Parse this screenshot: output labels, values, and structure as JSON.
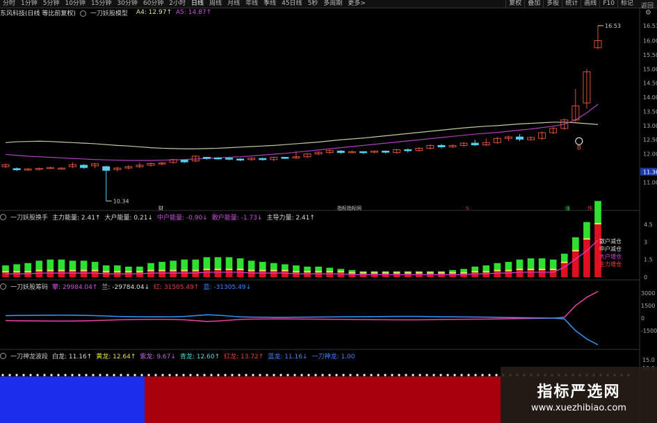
{
  "toolbar": {
    "periods": [
      "分时",
      "1分钟",
      "5分钟",
      "10分钟",
      "15分钟",
      "30分钟",
      "60分钟",
      "2小时",
      "日线",
      "周线",
      "月线",
      "年线",
      "季线",
      "45日线",
      "5秒",
      "多周期",
      "更多>"
    ],
    "active_index": 8,
    "right": [
      "复权",
      "叠加",
      "多股",
      "统计",
      "画线",
      "F10",
      "标记"
    ],
    "corner": "返回"
  },
  "main": {
    "stock": "东风科技(日线 等比前复权)",
    "indicator": "一刀妖股模型",
    "a4": "A4: 12.97↑",
    "a5": "A5: 14.87↑",
    "high_label": "16.53",
    "low_label": "10.34",
    "marker_b": "B",
    "bottom_labels": [
      "财",
      "指标指标网",
      "S",
      "涨",
      "炸"
    ],
    "axis": [
      "16.53",
      "16.00",
      "15.50",
      "15.00",
      "14.50",
      "14.00",
      "13.50",
      "13.00",
      "12.50",
      "12.00",
      "11.36",
      "11.00"
    ],
    "price_tag": "11.36"
  },
  "pane2": {
    "title": "一刀妖股换手",
    "items": [
      "主力能量: 2.41↑",
      "大户能量: 0.21↓",
      "中户能量: -0.90↓",
      "散户能量: -1.73↓",
      "主导力量: 2.41↑"
    ],
    "legend": [
      "散户减仓",
      "中户减仓",
      "大户增仓",
      "主力增仓"
    ],
    "axis": [
      "4.5",
      "3",
      "1.5",
      "0"
    ]
  },
  "pane3": {
    "title": "一刀妖股筹码",
    "items": [
      "攀: 29984.04↑",
      "兰: -29784.04↓",
      "红: 31505.49↑",
      "蓝: -31305.49↓"
    ],
    "axis": [
      "3000",
      "1500",
      "0",
      "-1500"
    ]
  },
  "pane4": {
    "title": "一刀神龙波段",
    "items": [
      "白龙: 11.16↑",
      "黄龙: 12.64↑",
      "紫龙: 9.67↓",
      "青龙: 12.60↑",
      "红龙: 13.72↑",
      "蓝龙: 11.16↓",
      "一刀神龙: 1.00"
    ],
    "axis": [
      "15.0",
      "10.0"
    ]
  },
  "watermark": {
    "title": "指标严选网",
    "url": "www.xuezhibiao.com"
  },
  "colors": {
    "up": "#e0503a",
    "down": "#5ad0f0",
    "ma1": "#c8c8a0",
    "ma2": "#b040c0"
  },
  "chart_data": {
    "type": "candlestick",
    "candles": [
      [
        11.55,
        11.62,
        11.5,
        11.66
      ],
      [
        11.48,
        11.44,
        11.4,
        11.52
      ],
      [
        11.43,
        11.47,
        11.4,
        11.5
      ],
      [
        11.45,
        11.49,
        11.42,
        11.52
      ],
      [
        11.5,
        11.52,
        11.48,
        11.55
      ],
      [
        11.5,
        11.5,
        11.47,
        11.53
      ],
      [
        11.55,
        11.62,
        11.5,
        11.7
      ],
      [
        11.6,
        11.52,
        11.48,
        11.64
      ],
      [
        11.58,
        11.65,
        11.5,
        11.68
      ],
      [
        11.55,
        11.42,
        10.34,
        11.58
      ],
      [
        11.45,
        11.5,
        11.38,
        11.55
      ],
      [
        11.5,
        11.55,
        11.45,
        11.6
      ],
      [
        11.55,
        11.6,
        11.5,
        11.7
      ],
      [
        11.6,
        11.66,
        11.55,
        11.7
      ],
      [
        11.65,
        11.68,
        11.6,
        11.72
      ],
      [
        11.7,
        11.8,
        11.65,
        11.83
      ],
      [
        11.78,
        11.72,
        11.68,
        11.8
      ],
      [
        11.75,
        11.92,
        11.72,
        11.95
      ],
      [
        11.88,
        11.84,
        11.8,
        11.9
      ],
      [
        11.86,
        11.84,
        11.8,
        11.88
      ],
      [
        11.85,
        11.82,
        11.78,
        11.88
      ],
      [
        11.82,
        11.8,
        11.75,
        11.85
      ],
      [
        11.8,
        11.85,
        11.76,
        11.88
      ],
      [
        11.84,
        11.8,
        11.76,
        11.86
      ],
      [
        11.8,
        11.88,
        11.75,
        11.9
      ],
      [
        11.88,
        11.86,
        11.82,
        11.9
      ],
      [
        11.86,
        11.9,
        11.82,
        12.1
      ],
      [
        11.9,
        12.0,
        11.85,
        12.03
      ],
      [
        12.0,
        12.06,
        11.95,
        12.1
      ],
      [
        12.05,
        12.12,
        12.0,
        12.15
      ],
      [
        12.1,
        12.05,
        12.0,
        12.14
      ],
      [
        12.05,
        12.08,
        12.02,
        12.12
      ],
      [
        12.08,
        12.05,
        12.0,
        12.1
      ],
      [
        12.06,
        12.1,
        12.02,
        12.12
      ],
      [
        12.1,
        12.06,
        12.02,
        12.12
      ],
      [
        12.05,
        12.15,
        12.0,
        12.18
      ],
      [
        12.15,
        12.12,
        12.05,
        12.2
      ],
      [
        12.12,
        12.2,
        12.08,
        12.24
      ],
      [
        12.2,
        12.3,
        12.15,
        12.34
      ],
      [
        12.3,
        12.25,
        12.2,
        12.35
      ],
      [
        12.25,
        12.3,
        12.2,
        12.34
      ],
      [
        12.3,
        12.38,
        12.25,
        12.42
      ],
      [
        12.38,
        12.32,
        12.28,
        12.5
      ],
      [
        12.32,
        12.4,
        12.28,
        12.55
      ],
      [
        12.4,
        12.55,
        12.35,
        12.6
      ],
      [
        12.55,
        12.6,
        12.45,
        12.65
      ],
      [
        12.6,
        12.52,
        12.45,
        12.7
      ],
      [
        12.5,
        12.58,
        12.48,
        12.62
      ],
      [
        12.55,
        12.75,
        12.5,
        12.8
      ],
      [
        12.75,
        12.9,
        12.7,
        12.95
      ],
      [
        12.9,
        13.2,
        12.85,
        13.25
      ],
      [
        13.2,
        13.7,
        13.1,
        14.3
      ],
      [
        13.8,
        14.9,
        13.6,
        15.0
      ],
      [
        15.75,
        16.0,
        15.7,
        16.53
      ]
    ],
    "ma_long": [
      12.4,
      12.43,
      12.44,
      12.45,
      12.44,
      12.42,
      12.4,
      12.38,
      12.36,
      12.33,
      12.3,
      12.28,
      12.25,
      12.22,
      12.2,
      12.19,
      12.18,
      12.18,
      12.19,
      12.2,
      12.22,
      12.24,
      12.26,
      12.28,
      12.3,
      12.33,
      12.36,
      12.39,
      12.42,
      12.46,
      12.5,
      12.53,
      12.56,
      12.6,
      12.64,
      12.68,
      12.72,
      12.76,
      12.8,
      12.84,
      12.88,
      12.92,
      12.95,
      12.98,
      13.0,
      13.03,
      13.06,
      13.08,
      13.1,
      13.12,
      13.12,
      13.1,
      13.07,
      13.04
    ],
    "ma_short": [
      11.98,
      11.95,
      11.92,
      11.9,
      11.88,
      11.86,
      11.84,
      11.82,
      11.8,
      11.79,
      11.78,
      11.77,
      11.77,
      11.77,
      11.78,
      11.79,
      11.8,
      11.82,
      11.84,
      11.86,
      11.88,
      11.9,
      11.93,
      11.96,
      11.99,
      12.02,
      12.06,
      12.1,
      12.14,
      12.18,
      12.22,
      12.26,
      12.3,
      12.34,
      12.38,
      12.42,
      12.46,
      12.5,
      12.54,
      12.58,
      12.62,
      12.66,
      12.7,
      12.73,
      12.76,
      12.8,
      12.84,
      12.88,
      12.93,
      12.98,
      13.05,
      13.2,
      13.45,
      13.75
    ],
    "volume_red": [
      0.4,
      0.4,
      0.4,
      0.5,
      0.5,
      0.5,
      0.5,
      0.5,
      0.5,
      0.4,
      0.4,
      0.4,
      0.4,
      0.5,
      0.5,
      0.5,
      0.5,
      0.5,
      0.6,
      0.6,
      0.6,
      0.6,
      0.5,
      0.5,
      0.5,
      0.5,
      0.4,
      0.4,
      0.4,
      0.4,
      0.4,
      0.3,
      0.3,
      0.3,
      0.3,
      0.3,
      0.3,
      0.3,
      0.3,
      0.3,
      0.3,
      0.3,
      0.4,
      0.4,
      0.5,
      0.5,
      0.6,
      0.6,
      0.6,
      0.6,
      1.2,
      2.2,
      3.2,
      4.5
    ],
    "volume_green": [
      0.6,
      0.7,
      0.8,
      0.9,
      1.0,
      1.0,
      0.9,
      0.9,
      0.8,
      0.6,
      0.6,
      0.5,
      0.5,
      0.7,
      0.8,
      0.9,
      1.0,
      1.0,
      1.1,
      1.1,
      1.1,
      1.0,
      0.9,
      0.8,
      0.7,
      0.6,
      0.6,
      0.5,
      0.5,
      0.4,
      0.3,
      0.3,
      0.2,
      0.2,
      0.2,
      0.2,
      0.2,
      0.2,
      0.2,
      0.2,
      0.3,
      0.4,
      0.5,
      0.6,
      0.7,
      0.8,
      0.9,
      1.0,
      1.0,
      0.9,
      0.8,
      1.2,
      1.5,
      2.0
    ],
    "chip_red": [
      -300,
      -320,
      -330,
      -340,
      -350,
      -360,
      -350,
      -330,
      -300,
      -250,
      -200,
      -180,
      -160,
      -150,
      -150,
      -160,
      -200,
      -300,
      -400,
      -350,
      -250,
      -150,
      -120,
      -110,
      -100,
      -100,
      -110,
      -120,
      -130,
      -140,
      -150,
      -160,
      -170,
      -180,
      -190,
      -200,
      -200,
      -200,
      -180,
      -160,
      -150,
      -140,
      -130,
      -120,
      -100,
      -80,
      -60,
      -40,
      -20,
      0,
      100,
      1500,
      2500,
      3200
    ],
    "chip_blue": [
      300,
      320,
      330,
      340,
      350,
      360,
      350,
      330,
      300,
      250,
      200,
      180,
      160,
      150,
      150,
      160,
      200,
      300,
      400,
      350,
      250,
      150,
      120,
      110,
      100,
      100,
      110,
      120,
      130,
      140,
      150,
      160,
      170,
      180,
      190,
      200,
      200,
      200,
      180,
      160,
      150,
      140,
      130,
      120,
      100,
      80,
      60,
      40,
      20,
      0,
      -100,
      -1500,
      -2500,
      -3200
    ]
  }
}
